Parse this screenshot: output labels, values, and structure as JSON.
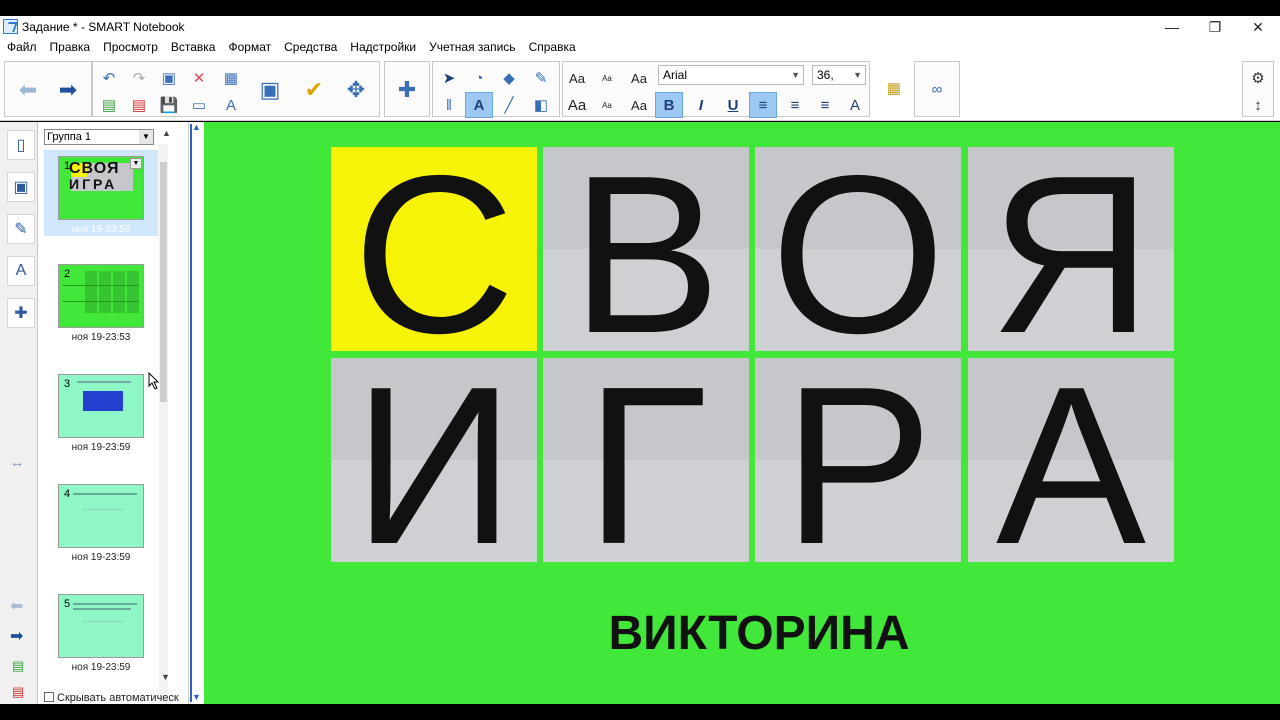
{
  "window": {
    "title": "Задание * - SMART Notebook",
    "minimize": "—",
    "restore": "❐",
    "close": "✕"
  },
  "menu": [
    "Файл",
    "Правка",
    "Просмотр",
    "Вставка",
    "Формат",
    "Средства",
    "Надстройки",
    "Учетная запись",
    "Справка"
  ],
  "toolbar": {
    "font_name": "Arial",
    "font_size": "36,",
    "bold": "B",
    "italic": "I",
    "underline": "U",
    "text_style_large": "Aa",
    "text_style_small": "Aa"
  },
  "sorter": {
    "group": "Группа 1",
    "autohide_label": "Скрывать автоматическ",
    "pages": [
      {
        "num": "1",
        "time": "ноя 19-23:59",
        "selected": true
      },
      {
        "num": "2",
        "time": "ноя 19-23:53",
        "selected": false
      },
      {
        "num": "3",
        "time": "ноя 19-23:59",
        "selected": false
      },
      {
        "num": "4",
        "time": "ноя 19-23:59",
        "selected": false
      },
      {
        "num": "5",
        "time": "ноя 19-23:59",
        "selected": false
      }
    ]
  },
  "slide": {
    "letters_row1": [
      "С",
      "В",
      "О",
      "Я"
    ],
    "letters_row2": [
      "И",
      "Г",
      "Р",
      "А"
    ],
    "subtitle": "ВИКТОРИНА",
    "thumb1_line1": "СВОЯ",
    "thumb1_line2": "ИГРА"
  },
  "colors": {
    "canvas_bg": "#41e83a",
    "highlight_tile": "#f7f306",
    "tile_gray": "#c6c7cb",
    "selection_blue": "#cfe6fb"
  }
}
